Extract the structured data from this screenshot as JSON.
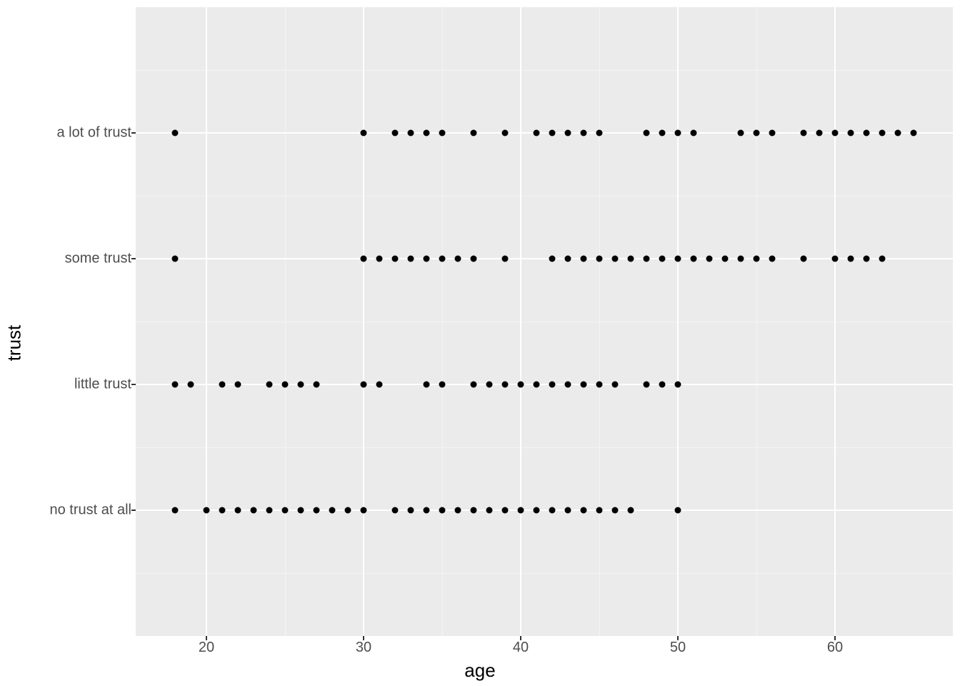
{
  "chart_data": {
    "type": "scatter",
    "xlabel": "age",
    "ylabel": "trust",
    "xlim": [
      15.5,
      67.5
    ],
    "x_ticks": [
      20,
      30,
      40,
      50,
      60
    ],
    "y_categories": [
      "no trust at all",
      "little trust",
      "some trust",
      "a lot of trust"
    ],
    "series": [
      {
        "name": "no trust at all",
        "y_index": 0,
        "x": [
          18,
          20,
          21,
          22,
          23,
          24,
          25,
          26,
          27,
          28,
          29,
          30,
          32,
          33,
          34,
          35,
          36,
          37,
          38,
          39,
          40,
          41,
          42,
          43,
          44,
          45,
          46,
          47,
          50
        ]
      },
      {
        "name": "little trust",
        "y_index": 1,
        "x": [
          18,
          19,
          21,
          22,
          24,
          25,
          26,
          27,
          30,
          31,
          34,
          35,
          37,
          38,
          39,
          40,
          41,
          42,
          43,
          44,
          45,
          46,
          48,
          49,
          50
        ]
      },
      {
        "name": "some trust",
        "y_index": 2,
        "x": [
          18,
          30,
          31,
          32,
          33,
          34,
          35,
          36,
          37,
          39,
          42,
          43,
          44,
          45,
          46,
          47,
          48,
          49,
          50,
          51,
          52,
          53,
          54,
          55,
          56,
          58,
          60,
          61,
          62,
          63
        ]
      },
      {
        "name": "a lot of trust",
        "y_index": 3,
        "x": [
          18,
          30,
          32,
          33,
          34,
          35,
          37,
          39,
          41,
          42,
          43,
          44,
          45,
          48,
          49,
          50,
          51,
          54,
          55,
          56,
          58,
          59,
          60,
          61,
          62,
          63,
          64,
          65
        ]
      }
    ]
  },
  "labels": {
    "xlabel": "age",
    "ylabel": "trust",
    "x_ticks": {
      "0": "20",
      "1": "30",
      "2": "40",
      "3": "50",
      "4": "60"
    },
    "y_ticks": {
      "0": "no trust at all",
      "1": "little trust",
      "2": "some trust",
      "3": "a lot of trust"
    }
  }
}
